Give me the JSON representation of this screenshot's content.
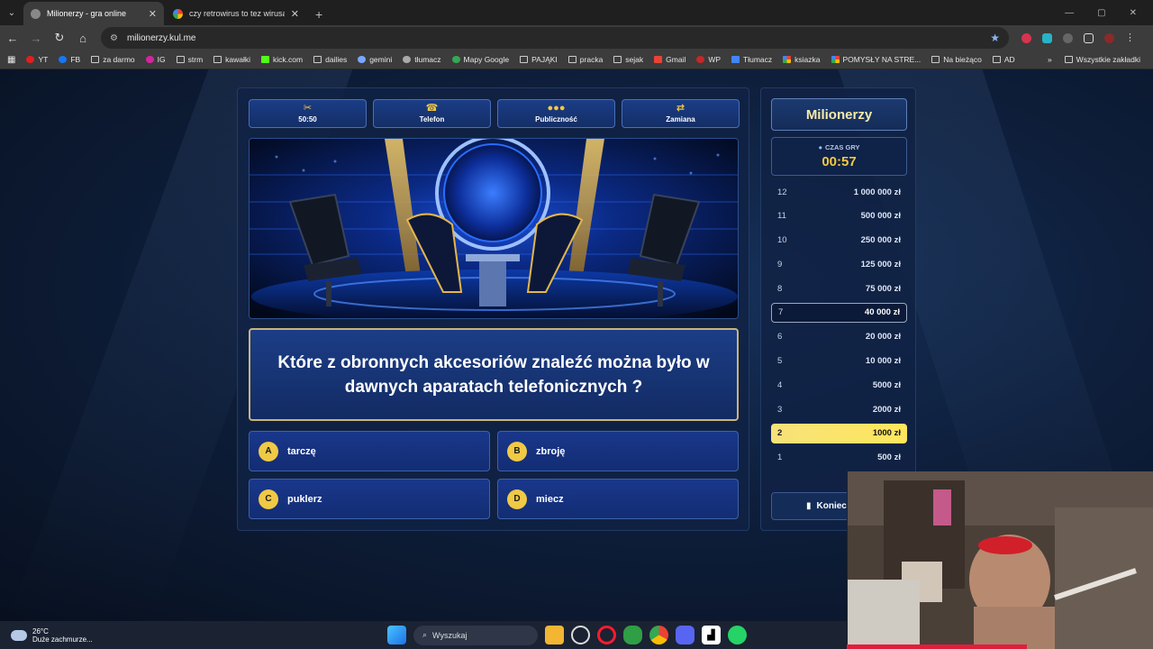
{
  "browser": {
    "tabs": [
      {
        "title": "Milionerzy - gra online",
        "active": true
      },
      {
        "title": "czy retrowirus to tez wirusa - S",
        "active": false
      }
    ],
    "url": "milionerzy.kul.me",
    "bookmarks": [
      "YT",
      "FB",
      "za darmo",
      "IG",
      "strm",
      "kawałki",
      "kick.com",
      "dailies",
      "gemini",
      "tłumacz",
      "Mapy Google",
      "PAJĄKI",
      "pracka",
      "sejak",
      "Gmail",
      "WP",
      "Tłumacz",
      "ksiazka",
      "POMYSŁY NA STRE...",
      "Na bieżąco",
      "AD"
    ],
    "all_bookmarks": "Wszystkie zakładki"
  },
  "game": {
    "lifelines": [
      {
        "label": "50:50",
        "icon": "scissors-icon"
      },
      {
        "label": "Telefon",
        "icon": "phone-icon"
      },
      {
        "label": "Publiczność",
        "icon": "audience-icon"
      },
      {
        "label": "Zamiana",
        "icon": "swap-icon"
      }
    ],
    "question": "Które z obronnych akcesoriów znaleźć można było w dawnych aparatach telefonicznych ?",
    "answers": [
      {
        "letter": "A",
        "text": "tarczę"
      },
      {
        "letter": "B",
        "text": "zbroję"
      },
      {
        "letter": "C",
        "text": "puklerz"
      },
      {
        "letter": "D",
        "text": "miecz"
      }
    ]
  },
  "sidebar": {
    "title": "Milionerzy",
    "timer_label": "CZAS GRY",
    "timer_value": "00:57",
    "ladder": [
      {
        "level": "12",
        "amount": "1 000 000 zł",
        "state": "normal"
      },
      {
        "level": "11",
        "amount": "500 000 zł",
        "state": "normal"
      },
      {
        "level": "10",
        "amount": "250 000 zł",
        "state": "normal"
      },
      {
        "level": "9",
        "amount": "125 000 zł",
        "state": "normal"
      },
      {
        "level": "8",
        "amount": "75 000 zł",
        "state": "normal"
      },
      {
        "level": "7",
        "amount": "40 000 zł",
        "state": "passed"
      },
      {
        "level": "6",
        "amount": "20 000 zł",
        "state": "normal"
      },
      {
        "level": "5",
        "amount": "10 000 zł",
        "state": "normal"
      },
      {
        "level": "4",
        "amount": "5000 zł",
        "state": "normal"
      },
      {
        "level": "3",
        "amount": "2000 zł",
        "state": "normal"
      },
      {
        "level": "2",
        "amount": "1000 zł",
        "state": "current"
      },
      {
        "level": "1",
        "amount": "500 zł",
        "state": "normal"
      }
    ],
    "quit_label": "Koniec"
  },
  "taskbar": {
    "temperature": "26°C",
    "weather": "Duże zachmurze...",
    "search_placeholder": "Wyszukaj"
  }
}
